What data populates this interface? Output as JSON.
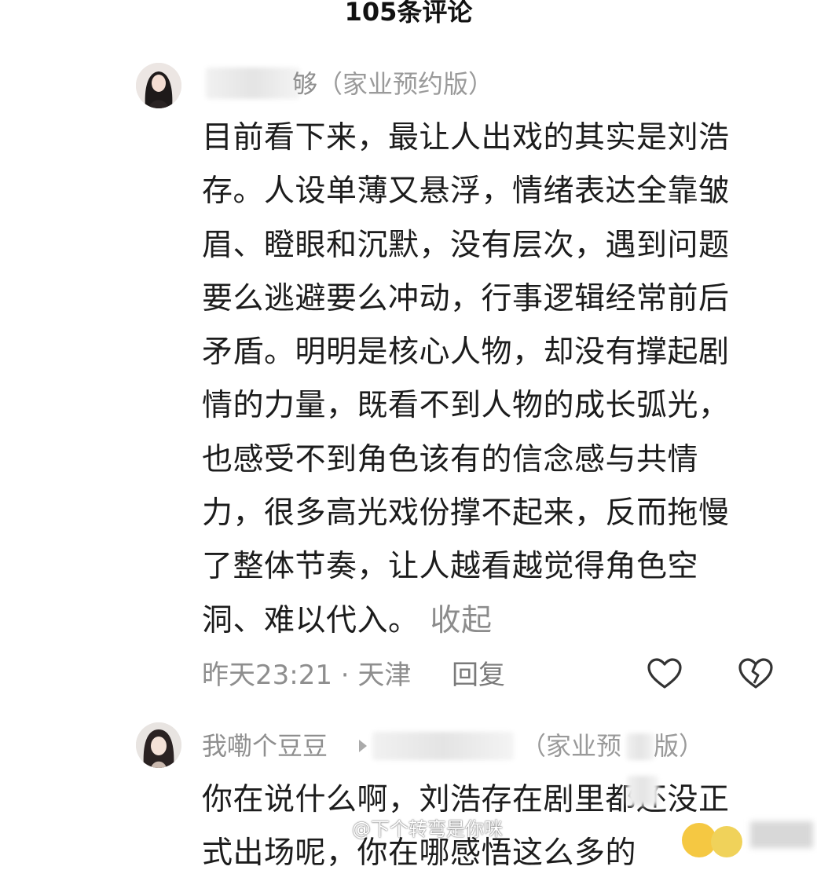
{
  "header": {
    "title": "105条评论"
  },
  "comments": [
    {
      "username_visible": "够",
      "tag": "（家业预约版）",
      "lines": [
        "目前看下来，最让人出戏的其实是刘浩",
        "存。人设单薄又悬浮，情绪表达全靠皱",
        "眉、瞪眼和沉默，没有层次，遇到问题",
        "要么逃避要么冲动，行事逻辑经常前后",
        "矛盾。明明是核心人物，却没有撑起剧",
        "情的力量，既看不到人物的成长弧光，",
        "也感受不到角色该有的信念感与共情",
        "力，很多高光戏份撑不起来，反而拖慢",
        "了整体节奏，让人越看越觉得角色空",
        "洞、难以代入。"
      ],
      "collapse_label": "收起",
      "meta": "昨天23:21 · 天津",
      "reply_label": "回复",
      "like_icon": "heart-outline-icon",
      "dislike_icon": "broken-heart-icon"
    },
    {
      "username_visible": "我嘞个豆豆",
      "tag_start": "（家业预",
      "tag_end": "版）",
      "lines": [
        "你在说什么啊，刘浩存在剧里都还没正",
        "式出场呢，你在哪感悟这么多的"
      ]
    }
  ],
  "watermark": {
    "text": "@下个转弯是你咪"
  }
}
